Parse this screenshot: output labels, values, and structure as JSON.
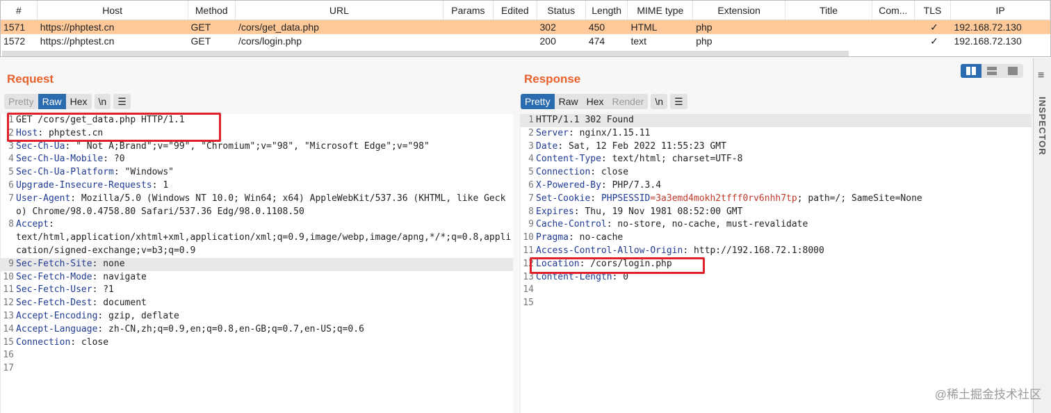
{
  "table": {
    "columns": [
      "#",
      "Host",
      "Method",
      "URL",
      "Params",
      "Edited",
      "Status",
      "Length",
      "MIME type",
      "Extension",
      "Title",
      "Com...",
      "TLS",
      "IP"
    ],
    "rows": [
      {
        "num": "1571",
        "host": "https://phptest.cn",
        "method": "GET",
        "url": "/cors/get_data.php",
        "status": "302",
        "length": "450",
        "mime": "HTML",
        "ext": "php",
        "tls": "✓",
        "ip": "192.168.72.130",
        "selected": true
      },
      {
        "num": "1572",
        "host": "https://phptest.cn",
        "method": "GET",
        "url": "/cors/login.php",
        "status": "200",
        "length": "474",
        "mime": "text",
        "ext": "php",
        "tls": "✓",
        "ip": "192.168.72.130",
        "selected": false
      }
    ]
  },
  "request": {
    "title": "Request",
    "tabs": [
      "Pretty",
      "Raw",
      "Hex"
    ],
    "active_tab": "Raw",
    "newline_btn": "\\n",
    "menu_icon": "☰",
    "lines": [
      {
        "n": "1",
        "k": "",
        "v": "GET /cors/get_data.php HTTP/1.1"
      },
      {
        "n": "2",
        "k": "Host",
        "v": ": phptest.cn"
      },
      {
        "n": "3",
        "k": "Sec-Ch-Ua",
        "v": ": \" Not A;Brand\";v=\"99\", \"Chromium\";v=\"98\", \"Microsoft Edge\";v=\"98\""
      },
      {
        "n": "4",
        "k": "Sec-Ch-Ua-Mobile",
        "v": ": ?0"
      },
      {
        "n": "5",
        "k": "Sec-Ch-Ua-Platform",
        "v": ": \"Windows\""
      },
      {
        "n": "6",
        "k": "Upgrade-Insecure-Requests",
        "v": ": 1"
      },
      {
        "n": "7",
        "k": "User-Agent",
        "v": ": Mozilla/5.0 (Windows NT 10.0; Win64; x64) AppleWebKit/537.36 (KHTML, like Gecko) Chrome/98.0.4758.80 Safari/537.36 Edg/98.0.1108.50"
      },
      {
        "n": "8",
        "k": "Accept",
        "v": ":\ntext/html,application/xhtml+xml,application/xml;q=0.9,image/webp,image/apng,*/*;q=0.8,application/signed-exchange;v=b3;q=0.9"
      },
      {
        "n": "9",
        "k": "Sec-Fetch-Site",
        "v": ": none",
        "hl": true
      },
      {
        "n": "10",
        "k": "Sec-Fetch-Mode",
        "v": ": navigate"
      },
      {
        "n": "11",
        "k": "Sec-Fetch-User",
        "v": ": ?1"
      },
      {
        "n": "12",
        "k": "Sec-Fetch-Dest",
        "v": ": document"
      },
      {
        "n": "13",
        "k": "Accept-Encoding",
        "v": ": gzip, deflate"
      },
      {
        "n": "14",
        "k": "Accept-Language",
        "v": ": zh-CN,zh;q=0.9,en;q=0.8,en-GB;q=0.7,en-US;q=0.6"
      },
      {
        "n": "15",
        "k": "Connection",
        "v": ": close"
      },
      {
        "n": "16",
        "k": "",
        "v": ""
      },
      {
        "n": "17",
        "k": "",
        "v": ""
      }
    ]
  },
  "response": {
    "title": "Response",
    "tabs": [
      "Pretty",
      "Raw",
      "Hex",
      "Render"
    ],
    "active_tab": "Pretty",
    "newline_btn": "\\n",
    "menu_icon": "☰",
    "lines": [
      {
        "n": "1",
        "k": "",
        "v": "HTTP/1.1 302 Found",
        "hl": true
      },
      {
        "n": "2",
        "k": "Server",
        "v": ": nginx/1.15.11"
      },
      {
        "n": "3",
        "k": "Date",
        "v": ": Sat, 12 Feb 2022 11:55:23 GMT"
      },
      {
        "n": "4",
        "k": "Content-Type",
        "v": ": text/html; charset=UTF-8"
      },
      {
        "n": "5",
        "k": "Connection",
        "v": ": close"
      },
      {
        "n": "6",
        "k": "X-Powered-By",
        "v": ": PHP/7.3.4"
      },
      {
        "n": "7",
        "k": "Set-Cookie",
        "v": ": ",
        "cookie_name": "PHPSESSID",
        "cookie_value": "=3a3emd4mokh2tfff0rv6nhh7tp",
        "rest": "; path=/; SameSite=None"
      },
      {
        "n": "8",
        "k": "Expires",
        "v": ": Thu, 19 Nov 1981 08:52:00 GMT"
      },
      {
        "n": "9",
        "k": "Cache-Control",
        "v": ": no-store, no-cache, must-revalidate"
      },
      {
        "n": "10",
        "k": "Pragma",
        "v": ": no-cache"
      },
      {
        "n": "11",
        "k": "Access-Control-Allow-Origin",
        "v": ": http://192.168.72.1:8000"
      },
      {
        "n": "12",
        "k": "Location",
        "v": ": /cors/login.php"
      },
      {
        "n": "13",
        "k": "Content-Length",
        "v": ": 0"
      },
      {
        "n": "14",
        "k": "",
        "v": ""
      },
      {
        "n": "15",
        "k": "",
        "v": ""
      }
    ]
  },
  "inspector": {
    "label": "INSPECTOR"
  },
  "watermark": "@稀土掘金技术社区",
  "colors": {
    "accent": "#e8612c",
    "selected_row": "#ffc999",
    "active_tab": "#2b6cb0",
    "highlight_box": "#e0202a"
  }
}
